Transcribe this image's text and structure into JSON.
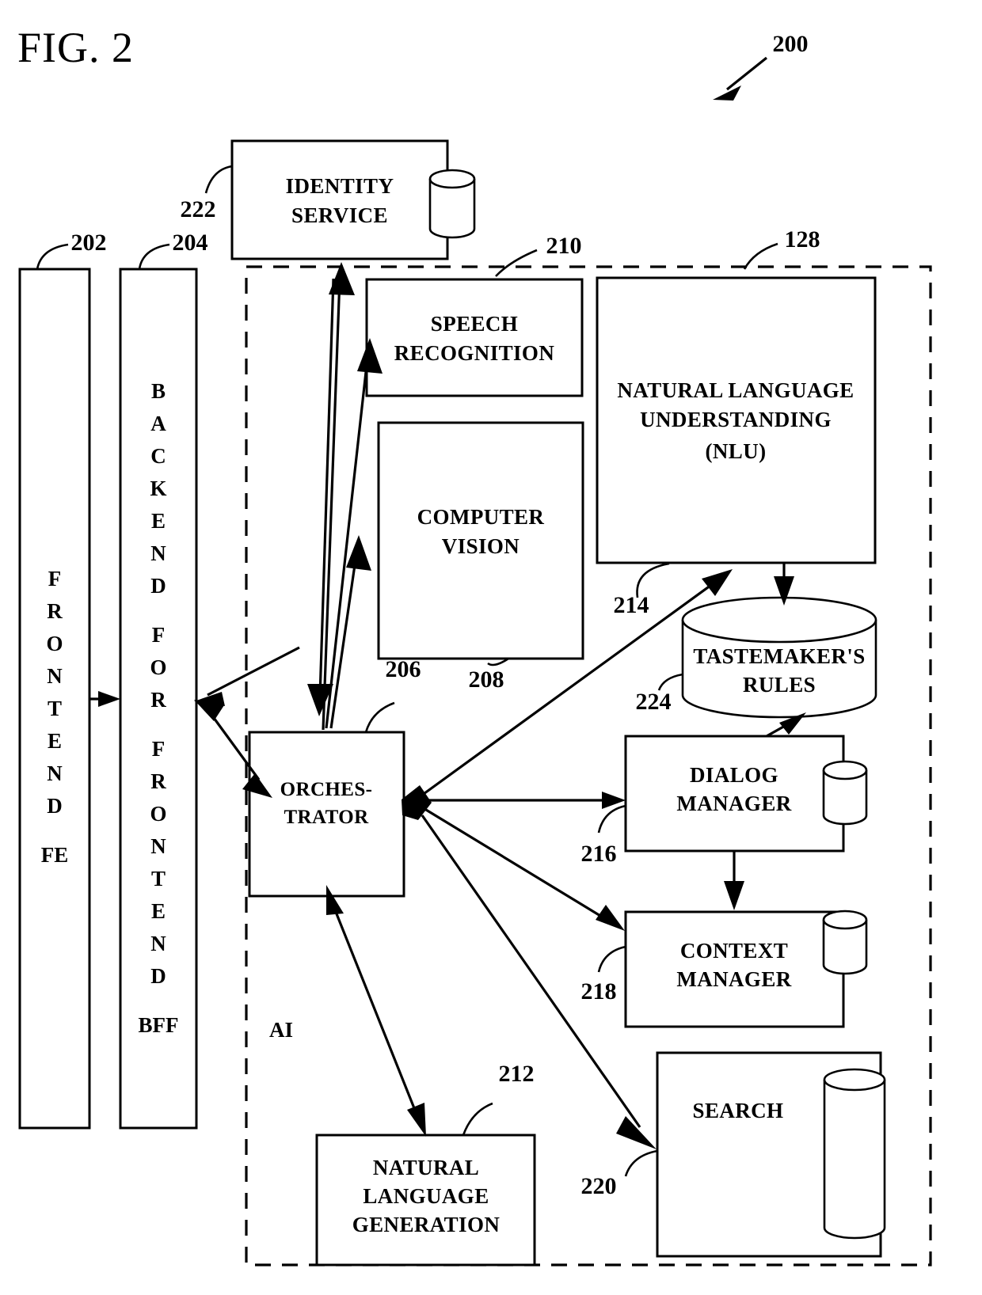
{
  "figure": {
    "title": "FIG. 2",
    "system_ref": "200"
  },
  "nodes": {
    "frontend": {
      "name": "FRONTEND",
      "letters": [
        "F",
        "R",
        "O",
        "N",
        "T",
        "E",
        "N",
        "D"
      ],
      "abbrev": "FE",
      "ref": "202"
    },
    "bff": {
      "name": "BACKEND FOR FRONTEND",
      "letters": [
        "B",
        "A",
        "C",
        "K",
        "E",
        "N",
        "D",
        "",
        "F",
        "O",
        "R",
        "",
        "F",
        "R",
        "O",
        "N",
        "T",
        "E",
        "N",
        "D"
      ],
      "abbrev": "BFF",
      "ref": "204"
    },
    "identity_service": {
      "line1": "IDENTITY",
      "line2": "SERVICE",
      "ref": "222",
      "has_database": true
    },
    "speech_recognition": {
      "line1": "SPEECH",
      "line2": "RECOGNITION",
      "ref": "210"
    },
    "computer_vision": {
      "line1": "COMPUTER",
      "line2": "VISION",
      "ref": "208"
    },
    "nlu": {
      "line1": "NATURAL LANGUAGE",
      "line2": "UNDERSTANDING",
      "line3": "(NLU)",
      "ref": "128"
    },
    "orchestrator": {
      "line1": "ORCHES-",
      "line2": "TRATOR",
      "ref": "206"
    },
    "tastemakers_rules": {
      "line1": "TASTEMAKER'S",
      "line2": "RULES",
      "ref": "224"
    },
    "dialog_manager": {
      "line1": "DIALOG",
      "line2": "MANAGER",
      "ref": "216",
      "has_database": true
    },
    "context_manager": {
      "line1": "CONTEXT",
      "line2": "MANAGER",
      "ref": "218",
      "has_database": true
    },
    "search": {
      "line1": "SEARCH",
      "ref": "220",
      "has_database": true
    },
    "nlg": {
      "line1": "NATURAL",
      "line2": "LANGUAGE",
      "line3": "GENERATION",
      "ref": "212"
    },
    "ai_region": {
      "label": "AI",
      "ref": "214"
    }
  },
  "refs": {
    "r200": "200",
    "r202": "202",
    "r204": "204",
    "r206": "206",
    "r208": "208",
    "r210": "210",
    "r212": "212",
    "r214": "214",
    "r216": "216",
    "r218": "218",
    "r220": "220",
    "r222": "222",
    "r224": "224",
    "r128": "128"
  },
  "colors": {
    "stroke": "#000000",
    "background": "#ffffff"
  }
}
